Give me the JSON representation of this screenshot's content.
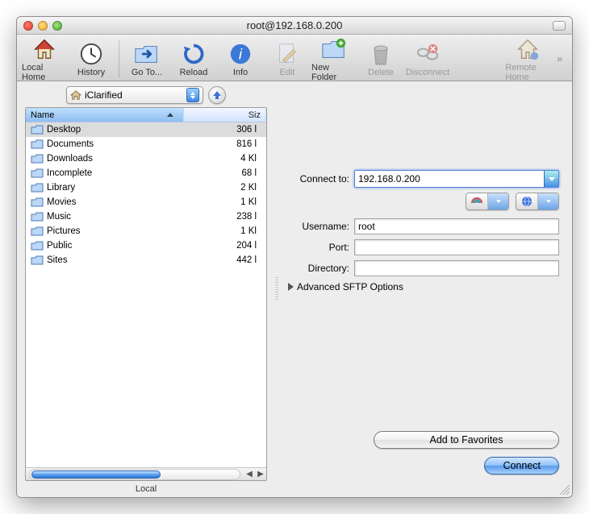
{
  "window": {
    "title": "root@192.168.0.200"
  },
  "toolbar": {
    "local_home": "Local Home",
    "history": "History",
    "goto": "Go To...",
    "reload": "Reload",
    "info": "Info",
    "edit": "Edit",
    "newfolder": "New Folder",
    "delete": "Delete",
    "disconnect": "Disconnect",
    "remote_home": "Remote Home"
  },
  "path_popup": {
    "label": "iClarified"
  },
  "columns": {
    "name": "Name",
    "size": "Siz"
  },
  "files": [
    {
      "name": "Desktop",
      "size": "306 l",
      "selected": true
    },
    {
      "name": "Documents",
      "size": "816 l"
    },
    {
      "name": "Downloads",
      "size": "4 Kl"
    },
    {
      "name": "Incomplete",
      "size": "68 l"
    },
    {
      "name": "Library",
      "size": "2 Kl"
    },
    {
      "name": "Movies",
      "size": "1 Kl"
    },
    {
      "name": "Music",
      "size": "238 l"
    },
    {
      "name": "Pictures",
      "size": "1 Kl"
    },
    {
      "name": "Public",
      "size": "204 l"
    },
    {
      "name": "Sites",
      "size": "442 l"
    }
  ],
  "pane_label_left": "Local",
  "form": {
    "connect_to_label": "Connect to:",
    "connect_to_value": "192.168.0.200",
    "username_label": "Username:",
    "username_value": "root",
    "port_label": "Port:",
    "port_value": "",
    "directory_label": "Directory:",
    "directory_value": "",
    "advanced": "Advanced SFTP Options",
    "add_favorites": "Add to Favorites",
    "connect": "Connect"
  }
}
